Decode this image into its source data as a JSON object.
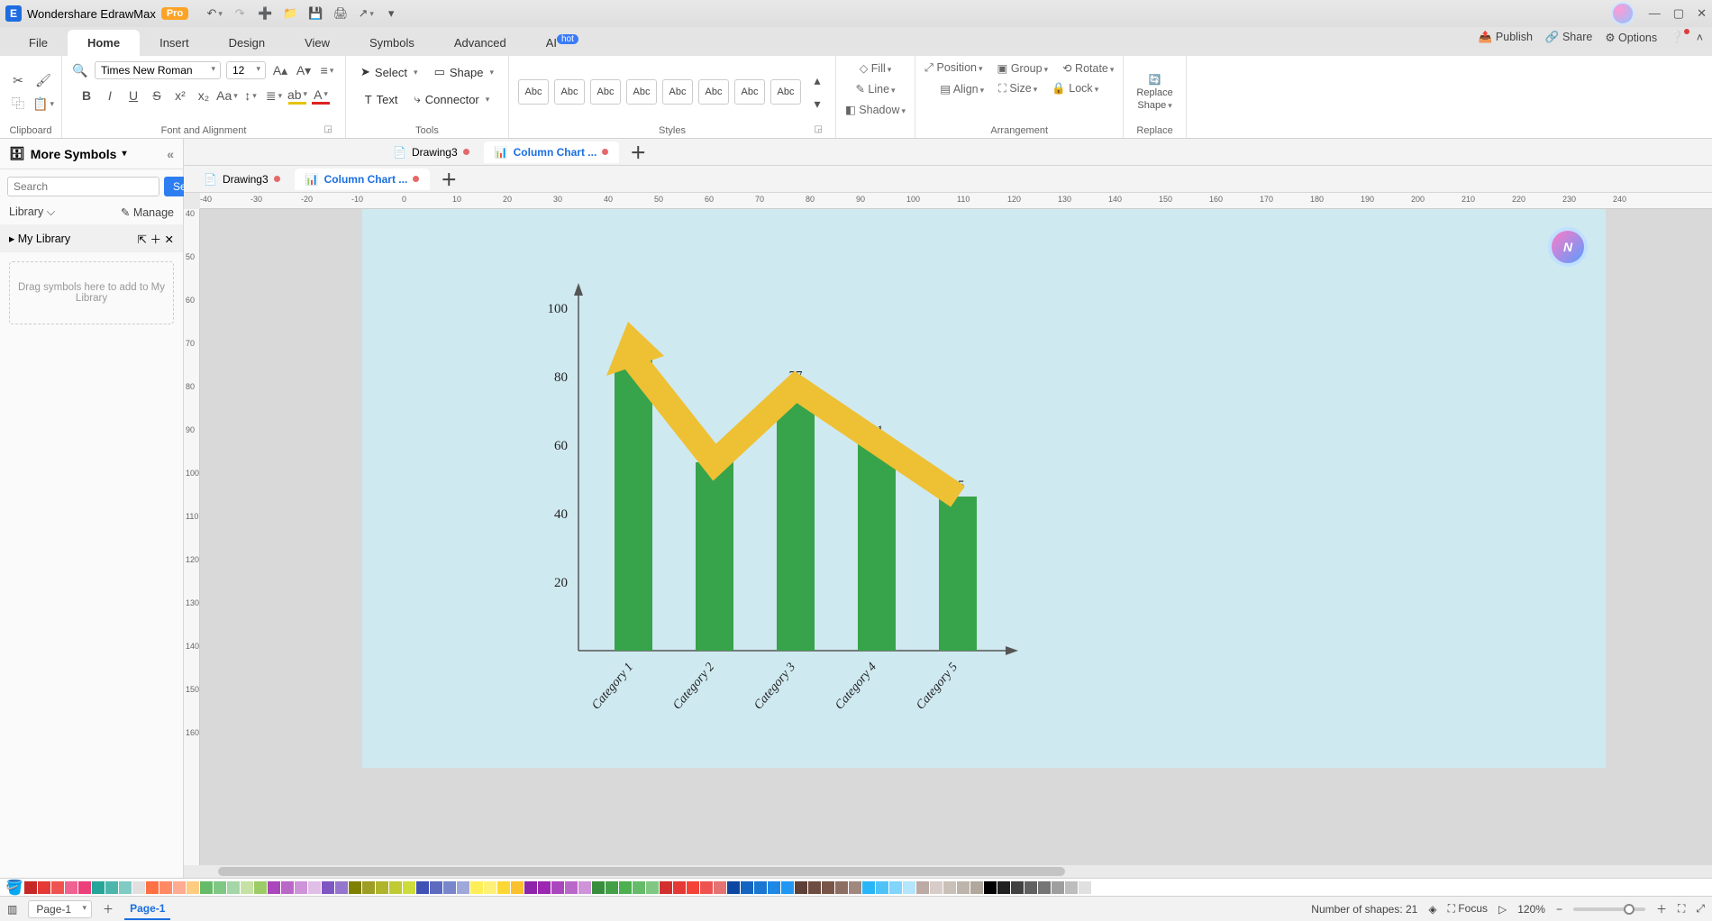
{
  "app": {
    "name": "Wondershare EdrawMax",
    "badge": "Pro"
  },
  "menu": {
    "tabs": [
      "File",
      "Home",
      "Insert",
      "Design",
      "View",
      "Symbols",
      "Advanced",
      "AI"
    ],
    "active": 1,
    "hot": "hot",
    "right": {
      "publish": "Publish",
      "share": "Share",
      "options": "Options"
    }
  },
  "ribbon": {
    "clipboard_label": "Clipboard",
    "font_name": "Times New Roman",
    "font_size": "12",
    "font_label": "Font and Alignment",
    "tools": {
      "select": "Select",
      "shape": "Shape",
      "text": "Text",
      "connector": "Connector",
      "label": "Tools"
    },
    "styles": {
      "abc": "Abc",
      "label": "Styles"
    },
    "style_props": {
      "fill": "Fill",
      "line": "Line",
      "shadow": "Shadow"
    },
    "arrange": {
      "position": "Position",
      "group": "Group",
      "rotate": "Rotate",
      "align": "Align",
      "size": "Size",
      "lock": "Lock",
      "label": "Arrangement"
    },
    "replace": {
      "shape1": "Replace",
      "shape2": "Shape",
      "label": "Replace"
    }
  },
  "doctabs": {
    "t1": "Drawing3",
    "t2": "Column Chart ..."
  },
  "left": {
    "header": "More Symbols",
    "search_placeholder": "Search",
    "search_btn": "Search",
    "library": "Library",
    "manage": "Manage",
    "mylib": "My Library",
    "drop": "Drag symbols here to add to My Library"
  },
  "ruler_h": [
    "-40",
    "-30",
    "-20",
    "-10",
    "0",
    "10",
    "20",
    "30",
    "40",
    "50",
    "60",
    "70",
    "80",
    "90",
    "100",
    "110",
    "120",
    "130",
    "140",
    "150",
    "160",
    "170",
    "180",
    "190",
    "200",
    "210",
    "220",
    "230",
    "240"
  ],
  "ruler_v": [
    "40",
    "50",
    "60",
    "70",
    "80",
    "90",
    "100",
    "110",
    "120",
    "130",
    "140",
    "150",
    "160"
  ],
  "status": {
    "page_sel": "Page-1",
    "page_tab": "Page-1",
    "shapes": "Number of shapes: 21",
    "focus": "Focus",
    "zoom": "120%"
  },
  "colors": [
    "#c62828",
    "#e53935",
    "#ef5350",
    "#f06292",
    "#ec407a",
    "#26a69a",
    "#4db6ac",
    "#80cbc4",
    "#e0e0e0",
    "#ff7043",
    "#ff8a65",
    "#ffab91",
    "#ffcc80",
    "#66bb6a",
    "#81c784",
    "#a5d6a7",
    "#c5e1a5",
    "#9ccc65",
    "#ab47bc",
    "#ba68c8",
    "#ce93d8",
    "#e1bee7",
    "#7e57c2",
    "#9575cd",
    "#808000",
    "#9e9d24",
    "#afb42b",
    "#c0ca33",
    "#cddc39",
    "#3f51b5",
    "#5c6bc0",
    "#7986cb",
    "#9fa8da",
    "#ffee58",
    "#fff176",
    "#fdd835",
    "#fbc02d",
    "#8e24aa",
    "#9c27b0",
    "#ab47bc",
    "#ba68c8",
    "#ce93d8",
    "#388e3c",
    "#43a047",
    "#4caf50",
    "#66bb6a",
    "#81c784",
    "#d32f2f",
    "#e53935",
    "#f44336",
    "#ef5350",
    "#e57373",
    "#0d47a1",
    "#1565c0",
    "#1976d2",
    "#1e88e5",
    "#2196f3",
    "#5d4037",
    "#6d4c41",
    "#795548",
    "#8d6e63",
    "#a1887f",
    "#29b6f6",
    "#4fc3f7",
    "#81d4fa",
    "#b3e5fc",
    "#bcaaa4",
    "#d7ccc8",
    "#c9c0b8",
    "#bdb5ab",
    "#b0a89d",
    "#000000",
    "#212121",
    "#424242",
    "#616161",
    "#757575",
    "#9e9e9e",
    "#bdbdbd",
    "#e0e0e0",
    "#ffffff"
  ],
  "chart_data": {
    "type": "bar",
    "categories": [
      "Category 1",
      "Category 2",
      "Category 3",
      "Category 4",
      "Category 5"
    ],
    "values": [
      85,
      55,
      77,
      61,
      45
    ],
    "ylim": [
      0,
      100
    ],
    "yticks": [
      20,
      40,
      60,
      80,
      100
    ],
    "overlay": "trend-arrow-down",
    "title": "",
    "xlabel": "",
    "ylabel": ""
  }
}
